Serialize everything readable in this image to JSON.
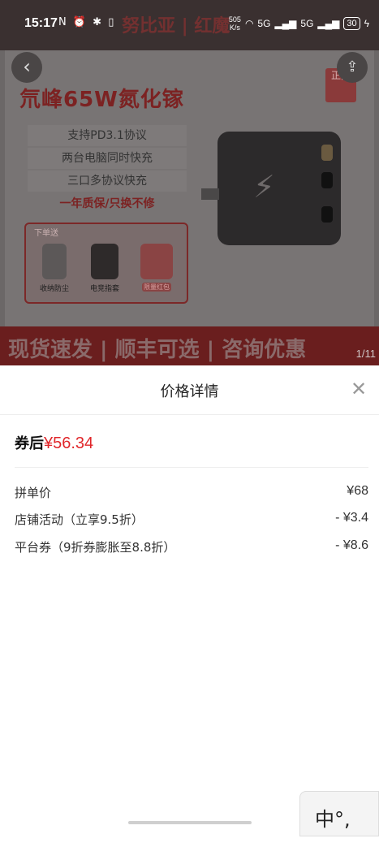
{
  "status_bar": {
    "time": "15:17",
    "net_speed_value": "505",
    "net_speed_unit": "K/s",
    "network_1": "5G",
    "network_2": "5G",
    "battery": "30"
  },
  "background_banner": {
    "brand_text": "努比亚 | 红魔"
  },
  "product_image": {
    "title": "氘峰65W氮化镓",
    "authentic_stamp": "正品",
    "features": [
      "支持PD3.1协议",
      "两台电脑同时快充",
      "三口多协议快充"
    ],
    "warranty": "一年质保/只换不修",
    "gift_label": "下单送",
    "gifts": [
      "收纳防尘",
      "电竞指套",
      "限量红包"
    ],
    "promo_strip": "现货速发 | 顺丰可选 | 咨询优惠",
    "page_counter": "1/11"
  },
  "price_sheet": {
    "title": "价格详情",
    "after_coupon_label": "券后",
    "after_coupon_price": "¥56.34",
    "rows": [
      {
        "label": "拼单价",
        "value": "¥68"
      },
      {
        "label": "店铺活动（立享9.5折）",
        "value": "- ¥3.4"
      },
      {
        "label": "平台券（9折券膨胀至8.8折）",
        "value": "- ¥8.6"
      }
    ]
  },
  "keyboard_peek": {
    "text": "中°,"
  }
}
